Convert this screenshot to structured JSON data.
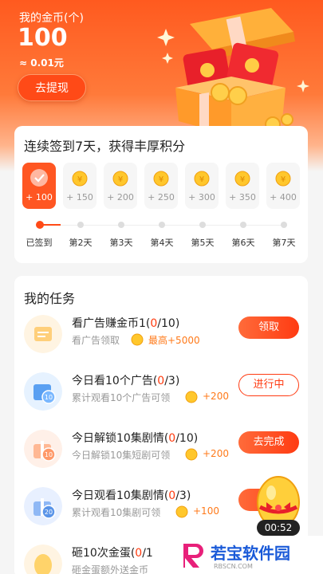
{
  "header": {
    "coin_label": "我的金币(个)",
    "coin_value": "100",
    "coin_money": "≈ 0.01元",
    "withdraw_label": "去提现"
  },
  "signin": {
    "title": "连续签到7天，获得丰厚积分",
    "days": [
      {
        "points": "+ 100",
        "label": "已签到",
        "active": true
      },
      {
        "points": "+ 150",
        "label": "第2天",
        "active": false
      },
      {
        "points": "+ 200",
        "label": "第3天",
        "active": false
      },
      {
        "points": "+ 250",
        "label": "第4天",
        "active": false
      },
      {
        "points": "+ 300",
        "label": "第5天",
        "active": false
      },
      {
        "points": "+ 350",
        "label": "第6天",
        "active": false
      },
      {
        "points": "+ 400",
        "label": "第7天",
        "active": false
      }
    ]
  },
  "tasks": {
    "title": "我的任务",
    "items": [
      {
        "name_prefix": "看广告赚金币1(",
        "progress": "0",
        "name_suffix": "/10)",
        "desc": "看广告领取",
        "bonus": "最高+5000",
        "button": "领取",
        "button_style": "solid",
        "icon": "ad-box-icon"
      },
      {
        "name_prefix": "今日看10个广告(",
        "progress": "0",
        "name_suffix": "/3)",
        "desc": "累计观看10个广告可领",
        "bonus": "+200",
        "button": "进行中",
        "button_style": "outline",
        "icon": "calendar-10-icon"
      },
      {
        "name_prefix": "今日解锁10集剧情(",
        "progress": "0",
        "name_suffix": "/10)",
        "desc": "今日解锁10集短剧可领",
        "bonus": "+200",
        "button": "去完成",
        "button_style": "solid",
        "icon": "gift-10-icon"
      },
      {
        "name_prefix": "今日观看10集剧情(",
        "progress": "0",
        "name_suffix": "/3)",
        "desc": "累计观看10集剧可领",
        "bonus": "+100",
        "button": "去",
        "button_style": "solid",
        "icon": "gift-20-icon"
      },
      {
        "name_prefix": "砸10次金蛋(",
        "progress": "0",
        "name_suffix": "/1",
        "desc": "砸金蛋额外送金币",
        "bonus": "",
        "button": "",
        "button_style": "none",
        "icon": "golden-egg-icon"
      }
    ]
  },
  "widget": {
    "timer": "00:52"
  },
  "watermark": {
    "text": "若宝软件园",
    "sub": "RBSCN.COM"
  },
  "colors": {
    "accent": "#ff4a17",
    "highlight": "#ff3b0f",
    "bonus": "#ff7a1a"
  }
}
